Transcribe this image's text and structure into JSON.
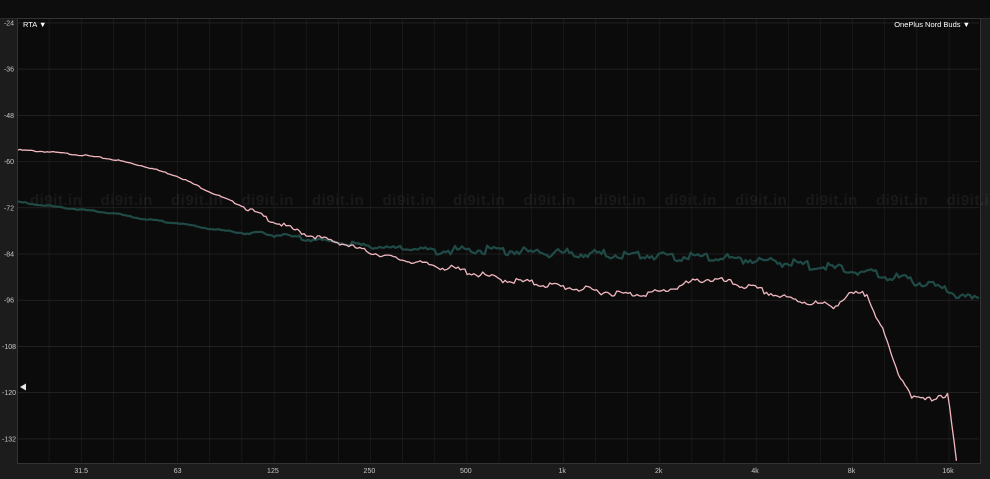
{
  "controls": {
    "mode_label": "RTA ▼",
    "device_label": "OnePlus Nord Buds ▼"
  },
  "watermark": "di9it.in",
  "colors": {
    "background": "#0b0b0b",
    "grid": "#3a3a3a",
    "measured": "#f2b8c0",
    "noise_floor": "#1f4a46"
  },
  "chart_data": {
    "type": "line",
    "title": "",
    "xlabel": "",
    "ylabel": "",
    "x_scale": "log",
    "xlim": [
      20,
      20000
    ],
    "ylim": [
      -138,
      -23
    ],
    "grid": true,
    "y_ticks": [
      -24,
      -36,
      -48,
      -60,
      -72,
      -84,
      -96,
      -108,
      -120,
      -132
    ],
    "x_ticks": [
      {
        "value": 31.5,
        "label": "31.5"
      },
      {
        "value": 63,
        "label": "63"
      },
      {
        "value": 125,
        "label": "125"
      },
      {
        "value": 250,
        "label": "250"
      },
      {
        "value": 500,
        "label": "500"
      },
      {
        "value": 1000,
        "label": "1k"
      },
      {
        "value": 2000,
        "label": "2k"
      },
      {
        "value": 4000,
        "label": "4k"
      },
      {
        "value": 8000,
        "label": "8k"
      },
      {
        "value": 16000,
        "label": "16k"
      }
    ],
    "series": [
      {
        "color": "#f2b8c0",
        "x": [
          20,
          25,
          31.5,
          40,
          50,
          63,
          80,
          100,
          125,
          160,
          200,
          250,
          315,
          400,
          500,
          630,
          800,
          1000,
          1250,
          1600,
          2000,
          2500,
          2800,
          3150,
          4000,
          5000,
          6300,
          7000,
          8000,
          9000,
          10000,
          11000,
          12500,
          14000,
          15000,
          16000,
          17000
        ],
        "y": [
          -57,
          -57.5,
          -58.3,
          -59.5,
          -61.3,
          -63.8,
          -68,
          -71.5,
          -75.5,
          -79,
          -81,
          -83.5,
          -85.5,
          -87,
          -88.5,
          -90.5,
          -91.5,
          -92.5,
          -93.5,
          -94.5,
          -94,
          -91.5,
          -90.5,
          -91,
          -93,
          -95.5,
          -97,
          -97.5,
          -94.5,
          -94.5,
          -104,
          -113.5,
          -121.5,
          -122,
          -120.5,
          -121,
          -138
        ]
      },
      {
        "color": "#1f4a46",
        "x": [
          20,
          25,
          31.5,
          40,
          50,
          63,
          80,
          100,
          125,
          160,
          200,
          250,
          315,
          400,
          500,
          630,
          800,
          1000,
          1250,
          1600,
          2000,
          2500,
          3150,
          4000,
          5000,
          6300,
          8000,
          10000,
          12500,
          16000,
          20000
        ],
        "y": [
          -70.5,
          -71.5,
          -72.5,
          -73.5,
          -75,
          -76,
          -77.5,
          -78.5,
          -79,
          -80,
          -81,
          -82,
          -82.5,
          -83,
          -83,
          -83,
          -83.5,
          -83.8,
          -84,
          -84.2,
          -84.5,
          -84.8,
          -85,
          -85.5,
          -86.3,
          -87.2,
          -88.2,
          -89.5,
          -91,
          -93.5,
          -96.5
        ]
      }
    ]
  }
}
